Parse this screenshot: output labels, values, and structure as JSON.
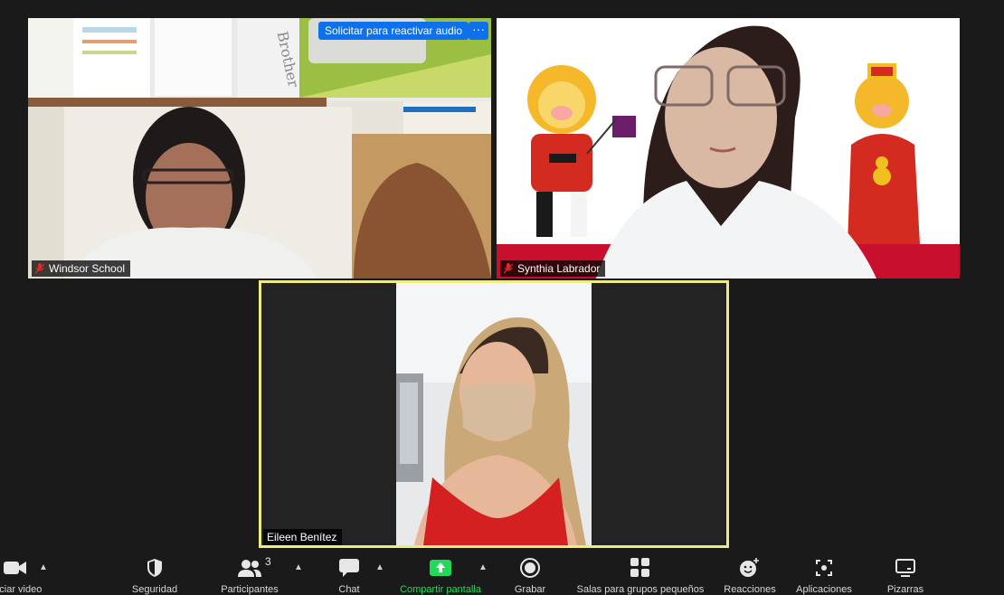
{
  "participants": [
    {
      "name": "Windsor School",
      "muted": true
    },
    {
      "name": "Synthia Labrador",
      "muted": true
    },
    {
      "name": "Eileen Benítez",
      "muted": false
    }
  ],
  "overlay": {
    "request_audio": "Solicitar para reactivar audio",
    "more": "···"
  },
  "wall_sign": "Brother",
  "toolbar": {
    "video": "Iniciar video",
    "security": "Seguridad",
    "participants": "Participantes",
    "participants_count": "3",
    "chat": "Chat",
    "share": "Compartir pantalla",
    "record": "Grabar",
    "breakout": "Salas para grupos pequeños",
    "reactions": "Reacciones",
    "apps": "Aplicaciones",
    "whiteboard": "Pizarras"
  },
  "colors": {
    "background": "#1a1a1a",
    "accent_blue": "#0e71eb",
    "active_speaker_border": "#f0ea82",
    "share_green": "#23d959",
    "muted_red": "#e02828"
  }
}
